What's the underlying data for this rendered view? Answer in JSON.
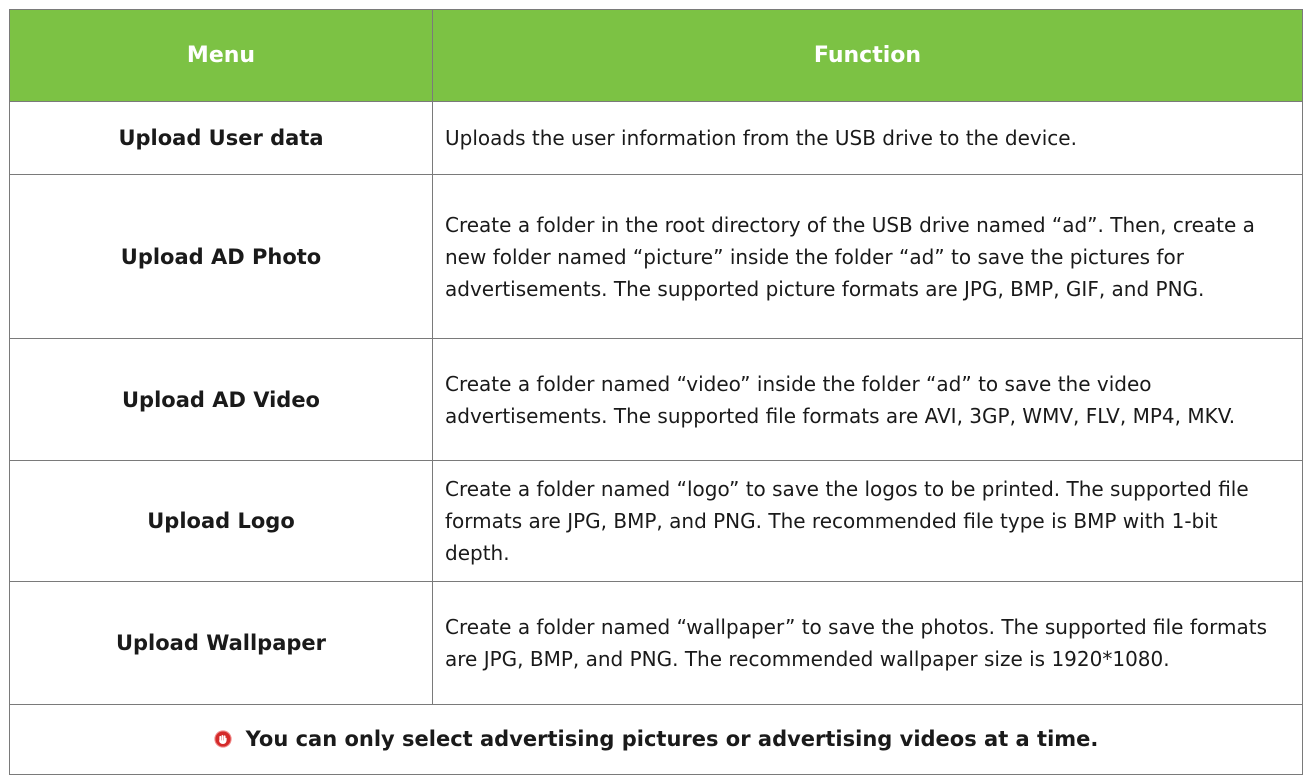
{
  "table": {
    "headers": [
      "Menu",
      "Function"
    ],
    "rows": [
      {
        "menu": "Upload User data",
        "function": "Uploads the user information from the USB drive to the device."
      },
      {
        "menu": "Upload AD Photo",
        "function": "Create a folder in the root directory of the USB drive named “ad”. Then, create a new folder named “picture” inside the folder “ad” to save the pictures for advertisements. The supported picture formats are JPG, BMP, GIF, and PNG."
      },
      {
        "menu": "Upload AD Video",
        "function": "Create a folder named “video” inside the folder “ad” to save the video advertisements. The supported file formats are AVI, 3GP, WMV, FLV, MP4, MKV."
      },
      {
        "menu": "Upload Logo",
        "function": "Create a folder named “logo” to save the logos to be printed. The supported file formats are JPG, BMP, and PNG. The recommended file type is BMP with 1-bit depth."
      },
      {
        "menu": "Upload Wallpaper",
        "function": "Create a folder named “wallpaper” to save the photos. The supported file formats are JPG, BMP, and PNG. The recommended wallpaper size is 1920*1080."
      }
    ],
    "note": {
      "icon": "stop-icon",
      "text": "You can only select advertising pictures or advertising videos at a time."
    }
  },
  "colors": {
    "header_bg": "#7cc244",
    "header_text": "#ffffff",
    "border": "#7a7a7a",
    "stop_icon": "#d42a2a"
  }
}
